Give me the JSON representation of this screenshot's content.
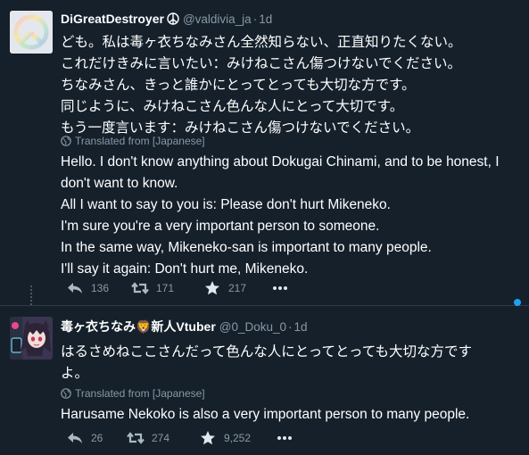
{
  "colors": {
    "background": "#15202b",
    "text": "#ffffff",
    "muted": "#8899a6",
    "accent": "#1da1f2",
    "divider": "#2f3b47"
  },
  "tweets": [
    {
      "display_name": "DiGreatDestroyer",
      "verified_icon": "peace-badge-icon",
      "handle": "@valdivia_ja",
      "separator": "·",
      "time": "1d",
      "avatar_icon": "peace-sign-avatar",
      "original_lines": [
        "ども。私は毒ヶ衣ちなみさん全然知らない、正直知りたくない。",
        "これだけきみに言いたい：みけねこさん傷つけないでください。",
        "ちなみさん、きっと誰かにとってとっても大切な方です。",
        "同じように、みけねこさん色んな人にとって大切です。",
        "もう一度言います：みけねこさん傷つけないでください。"
      ],
      "translated_label": "Translated from [Japanese]",
      "translation_lines": [
        "Hello. I don't know anything about Dokugai Chinami, and to be honest, I don't want to know.",
        "All I want to say to you is: Please don't hurt Mikeneko.",
        "I'm sure you're a very important person to someone.",
        "In the same way, Mikeneko-san is important to many people.",
        "I'll say it again: Don't hurt me, Mikeneko."
      ],
      "reply_count": "136",
      "retweet_count": "171",
      "like_count": "217"
    },
    {
      "display_name": "毒ヶ衣ちなみ🦁新人Vtuber",
      "handle": "@0_Doku_0",
      "separator": "·",
      "time": "1d",
      "avatar_icon": "anime-avatar",
      "original_lines": [
        "はるさめねここさんだって色んな人にとってとっても大切な方です",
        "よ。"
      ],
      "translated_label": "Translated from [Japanese]",
      "translation_lines": [
        "Harusame Nekoko is also a very important person to many people."
      ],
      "reply_count": "26",
      "retweet_count": "274",
      "like_count": "9,252"
    }
  ]
}
